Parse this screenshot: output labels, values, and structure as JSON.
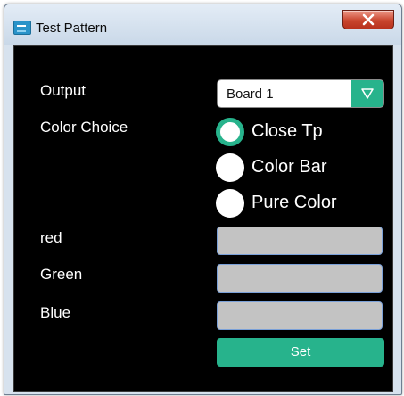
{
  "window": {
    "title": "Test Pattern",
    "app_icon": "app-icon",
    "close_icon": "close-x-icon"
  },
  "form": {
    "output": {
      "label": "Output",
      "selected": "Board 1",
      "arrow_icon": "triangle-down-icon"
    },
    "color_choice": {
      "label": "Color Choice",
      "options": [
        {
          "label": "Close Tp",
          "checked": true
        },
        {
          "label": "Color Bar",
          "checked": false
        },
        {
          "label": "Pure Color",
          "checked": false
        }
      ]
    },
    "red": {
      "label": "red",
      "value": ""
    },
    "green": {
      "label": "Green",
      "value": ""
    },
    "blue": {
      "label": "Blue",
      "value": ""
    },
    "set_label": "Set"
  },
  "colors": {
    "accent": "#27b38c",
    "panel_background": "#000000",
    "field_fill": "#c3c3c3",
    "close_button": "#c9452e"
  }
}
